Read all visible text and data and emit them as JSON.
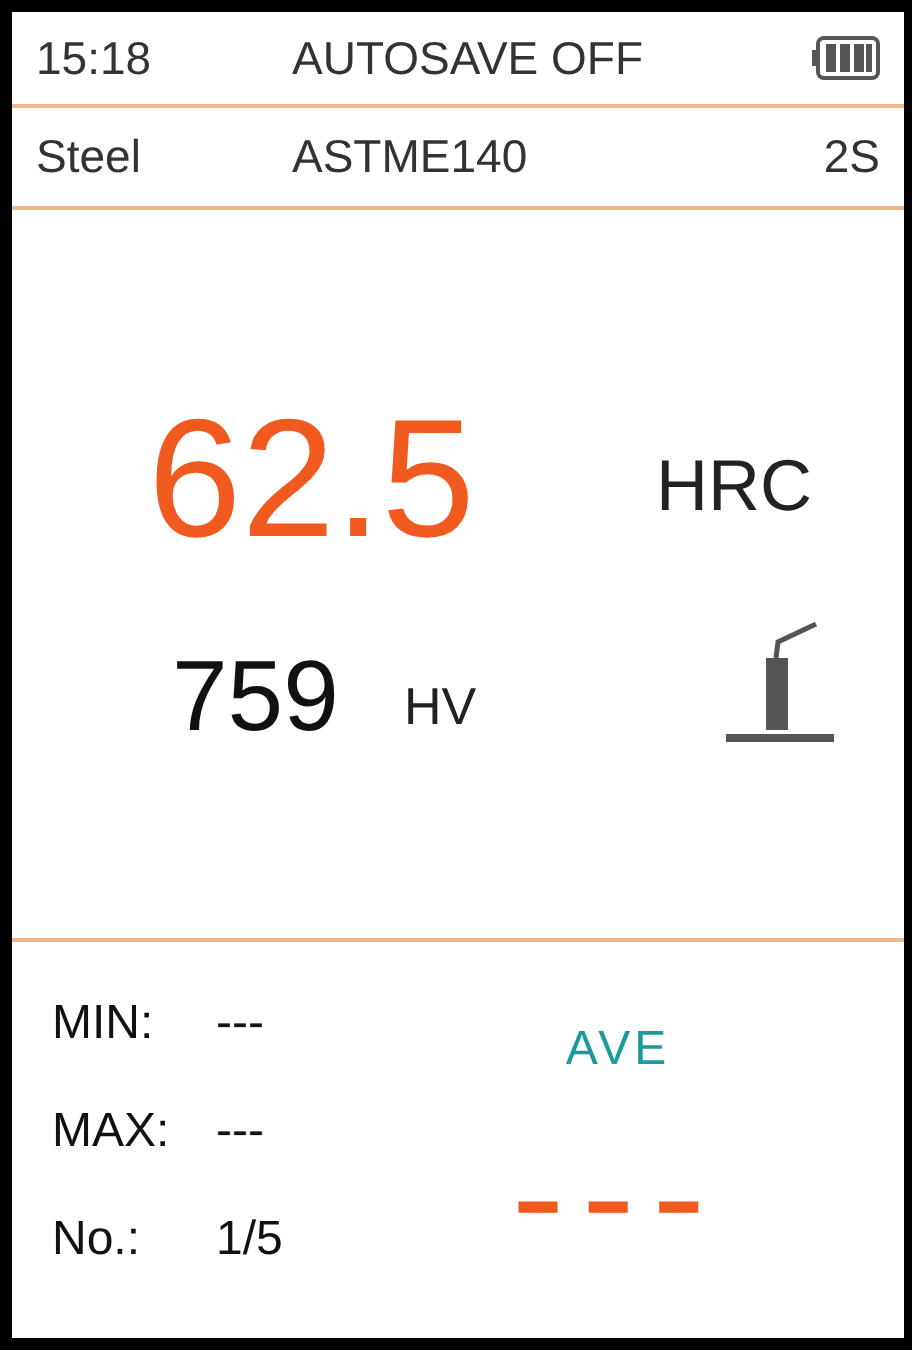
{
  "status_bar": {
    "time": "15:18",
    "autosave": "AUTOSAVE OFF"
  },
  "info_bar": {
    "material": "Steel",
    "standard": "ASTME140",
    "interval": "2S"
  },
  "reading": {
    "value": "62.5",
    "unit": "HRC"
  },
  "conversion": {
    "value": "759",
    "unit": "HV"
  },
  "stats": [
    {
      "label": "MIN:",
      "value": "---"
    },
    {
      "label": "MAX:",
      "value": "---"
    },
    {
      "label": "No.:",
      "value": "1/5"
    }
  ],
  "average": {
    "label": "AVE",
    "value": "---"
  }
}
